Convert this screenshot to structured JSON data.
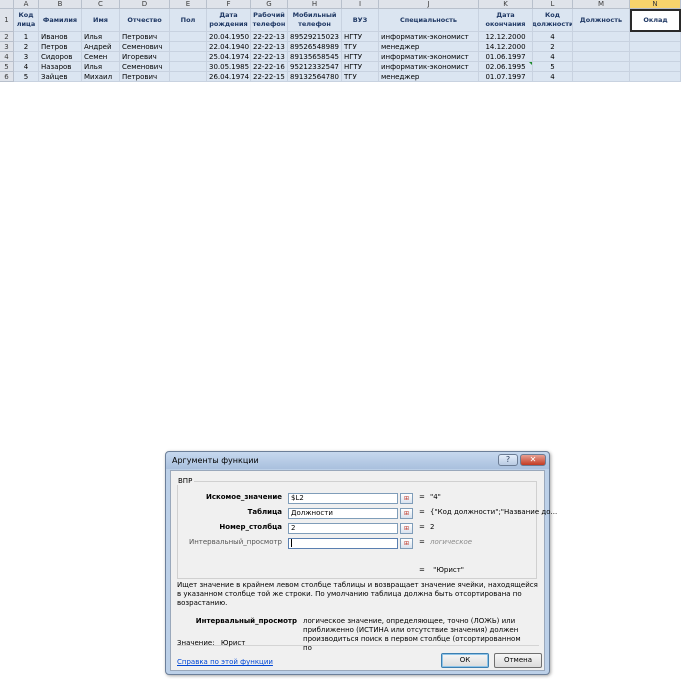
{
  "sheet": {
    "column_letters": [
      "A",
      "B",
      "C",
      "D",
      "E",
      "F",
      "G",
      "H",
      "I",
      "J",
      "K",
      "L",
      "M",
      "N"
    ],
    "row_numbers": [
      "1",
      "2",
      "3",
      "4",
      "5",
      "6"
    ],
    "headers": [
      "Код лица",
      "Фамилия",
      "Имя",
      "Отчество",
      "Пол",
      "Дата рождения",
      "Рабочий телефон",
      "Мобильный телефон",
      "ВУЗ",
      "Специальность",
      "Дата окончания",
      "Код должности",
      "Должность",
      "Оклад"
    ],
    "rows": [
      [
        "1",
        "Иванов",
        "Илья",
        "Петрович",
        "",
        "20.04.1950",
        "22-22-13",
        "89529215023",
        "НГТУ",
        "информатик-экономист",
        "12.12.2000",
        "4",
        "",
        ""
      ],
      [
        "2",
        "Петров",
        "Андрей",
        "Семенович",
        "",
        "22.04.1940",
        "22-22-13",
        "89526548989",
        "ТГУ",
        "менеджер",
        "14.12.2000",
        "2",
        "",
        ""
      ],
      [
        "3",
        "Сидоров",
        "Семен",
        "Игоревич",
        "",
        "25.04.1974",
        "22-22-13",
        "89135658545",
        "НГТУ",
        "информатик-экономист",
        "01.06.1997",
        "4",
        "",
        ""
      ],
      [
        "4",
        "Назаров",
        "Илья",
        "Семенович",
        "",
        "30.05.1985",
        "22-22-16",
        "95212332547",
        "НГТУ",
        "информатик-экономист",
        "02.06.1995",
        "5",
        "",
        ""
      ],
      [
        "5",
        "Зайцев",
        "Михаил",
        "Петрович",
        "",
        "26.04.1974",
        "22-22-15",
        "89132564780",
        "ТГУ",
        "менеджер",
        "01.07.1997",
        "4",
        "",
        ""
      ]
    ]
  },
  "dialog": {
    "title": "Аргументы функции",
    "help_glyph": "?",
    "close_glyph": "✕",
    "function_name": "ВПР",
    "args": [
      {
        "label": "Искомое_значение",
        "value": "$L2",
        "result": "\"4\""
      },
      {
        "label": "Таблица",
        "value": "Должности",
        "result": "{\"Код должности\";\"Название до..."
      },
      {
        "label": "Номер_столбца",
        "value": "2",
        "result": "2"
      },
      {
        "label": "Интервальный_просмотр",
        "value": "",
        "result": "логическое"
      }
    ],
    "ref_icon": "⊞",
    "eq_sign": "=",
    "formula_result": "\"Юрист\"",
    "description": "Ищет значение в крайнем левом столбце таблицы и возвращает значение ячейки, находящейся в указанном столбце той же строки. По умолчанию таблица должна быть отсортирована по возрастанию.",
    "arg_help_name": "Интервальный_просмотр",
    "arg_help_text": "логическое значение, определяющее, точно (ЛОЖЬ) или приближенно (ИСТИНА или отсутствие значения) должен производиться поиск в первом столбце (отсортированном по",
    "value_label": "Значение:",
    "value": "Юрист",
    "help_link": "Справка по этой функции",
    "ok_label": "ОК",
    "cancel_label": "Отмена"
  },
  "colors": {
    "accent": "#f8d46b",
    "table_fill": "#dbe5f1",
    "header_text": "#1f3864"
  }
}
